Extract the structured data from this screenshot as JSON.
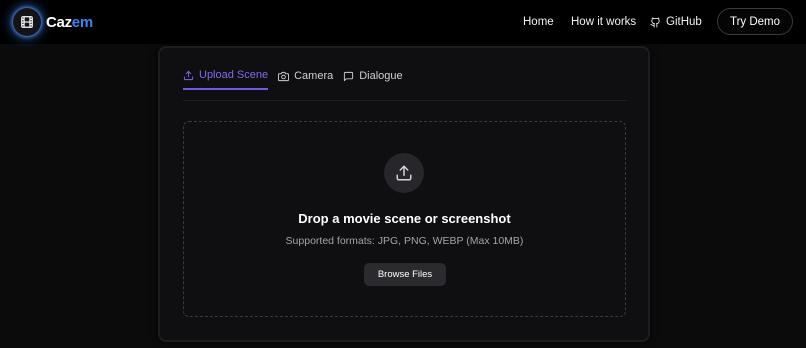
{
  "brand": {
    "name_part1": "Caz",
    "name_part2": "em",
    "logo_icon": "film-icon",
    "accent": "#3b82f6"
  },
  "nav": {
    "home": "Home",
    "how_it_works": "How it works",
    "github": "GitHub",
    "github_icon": "github-icon",
    "try_demo": "Try Demo"
  },
  "tabs": [
    {
      "label": "Upload Scene",
      "icon": "upload-icon",
      "active": true
    },
    {
      "label": "Camera",
      "icon": "camera-icon",
      "active": false
    },
    {
      "label": "Dialogue",
      "icon": "message-square-icon",
      "active": false
    }
  ],
  "dropzone": {
    "icon": "upload-icon",
    "title": "Drop a movie scene or screenshot",
    "subtitle": "Supported formats: JPG, PNG, WEBP (Max 10MB)",
    "browse_label": "Browse Files"
  },
  "colors": {
    "background": "#0b0b0c",
    "active_tab": "#7c6cf0",
    "text": "#e8e8ea"
  }
}
